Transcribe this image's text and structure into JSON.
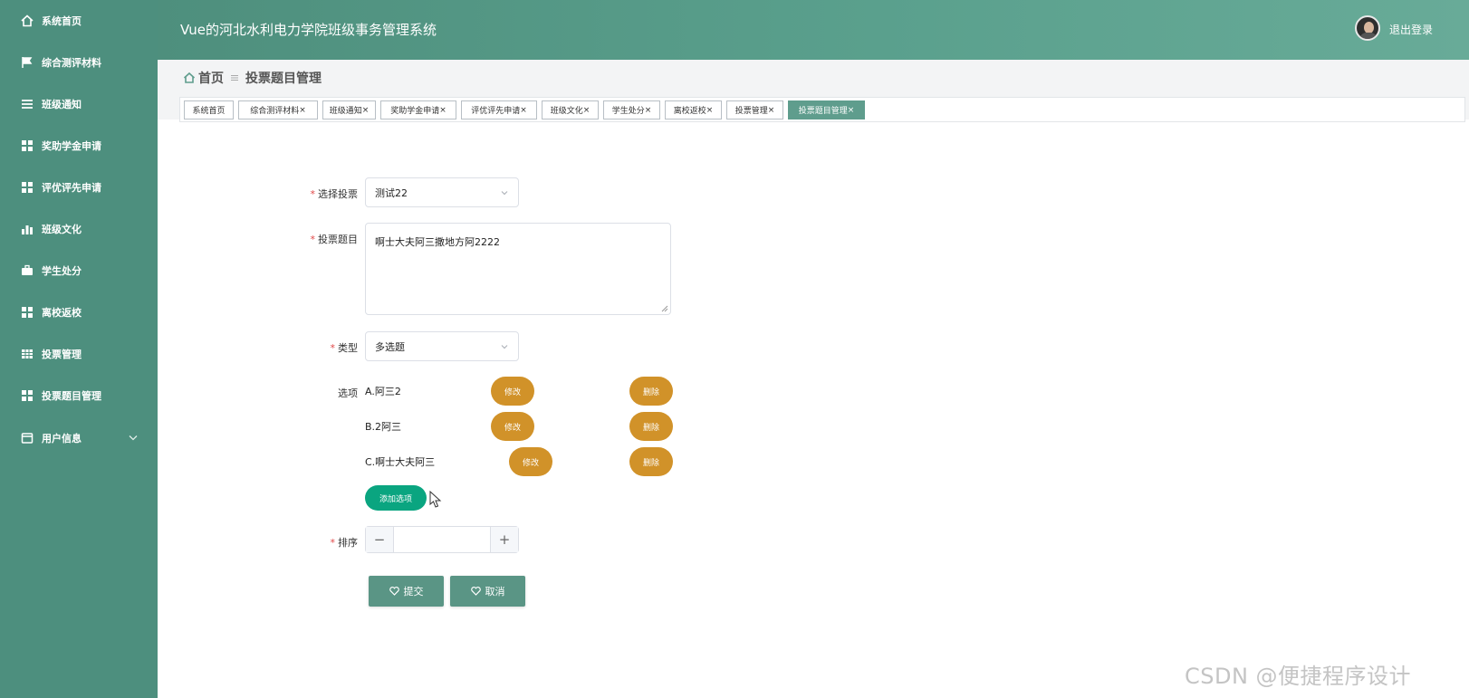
{
  "sidebar": {
    "items": [
      {
        "label": "系统首页",
        "icon": "home-icon"
      },
      {
        "label": "综合测评材料",
        "icon": "flag-icon"
      },
      {
        "label": "班级通知",
        "icon": "menu-icon"
      },
      {
        "label": "奖助学金申请",
        "icon": "grid-icon"
      },
      {
        "label": "评优评先申请",
        "icon": "grid-icon"
      },
      {
        "label": "班级文化",
        "icon": "bar-chart-icon"
      },
      {
        "label": "学生处分",
        "icon": "briefcase-icon"
      },
      {
        "label": "离校返校",
        "icon": "grid-icon"
      },
      {
        "label": "投票管理",
        "icon": "table-icon"
      },
      {
        "label": "投票题目管理",
        "icon": "grid-icon"
      },
      {
        "label": "用户信息",
        "icon": "window-icon",
        "expandable": true
      }
    ]
  },
  "header": {
    "title": "Vue的河北水利电力学院班级事务管理系统",
    "logout_label": "退出登录"
  },
  "breadcrumb": {
    "home": "首页",
    "current": "投票题目管理"
  },
  "tags": [
    {
      "label": "系统首页",
      "closable": false
    },
    {
      "label": "综合测评材料",
      "closable": true
    },
    {
      "label": "班级通知",
      "closable": true
    },
    {
      "label": "奖助学金申请",
      "closable": true
    },
    {
      "label": "评优评先申请",
      "closable": true
    },
    {
      "label": "班级文化",
      "closable": true
    },
    {
      "label": "学生处分",
      "closable": true
    },
    {
      "label": "离校返校",
      "closable": true
    },
    {
      "label": "投票管理",
      "closable": true
    },
    {
      "label": "投票题目管理",
      "closable": true,
      "active": true
    }
  ],
  "form": {
    "vote_label": "选择投票",
    "vote_value": "测试22",
    "question_label": "投票题目",
    "question_value": "啊士大夫阿三撒地方阿2222",
    "type_label": "类型",
    "type_value": "多选题",
    "options_label": "选项",
    "options": [
      {
        "text": "A.阿三2",
        "edit": "修改",
        "delete": "删除"
      },
      {
        "text": "B.2阿三",
        "edit": "修改",
        "delete": "删除"
      },
      {
        "text": "C.啊士大夫阿三",
        "edit": "修改",
        "delete": "删除"
      }
    ],
    "add_option_label": "添加选项",
    "sort_label": "排序",
    "sort_value": "",
    "submit_label": "提交",
    "cancel_label": "取消"
  },
  "colors": {
    "sidebar": "#4d8f7e",
    "header": "#5aa08d",
    "option_button": "#d19229",
    "add_button": "#0aa580",
    "action_button": "#5a9585"
  },
  "watermark": "CSDN @便捷程序设计"
}
